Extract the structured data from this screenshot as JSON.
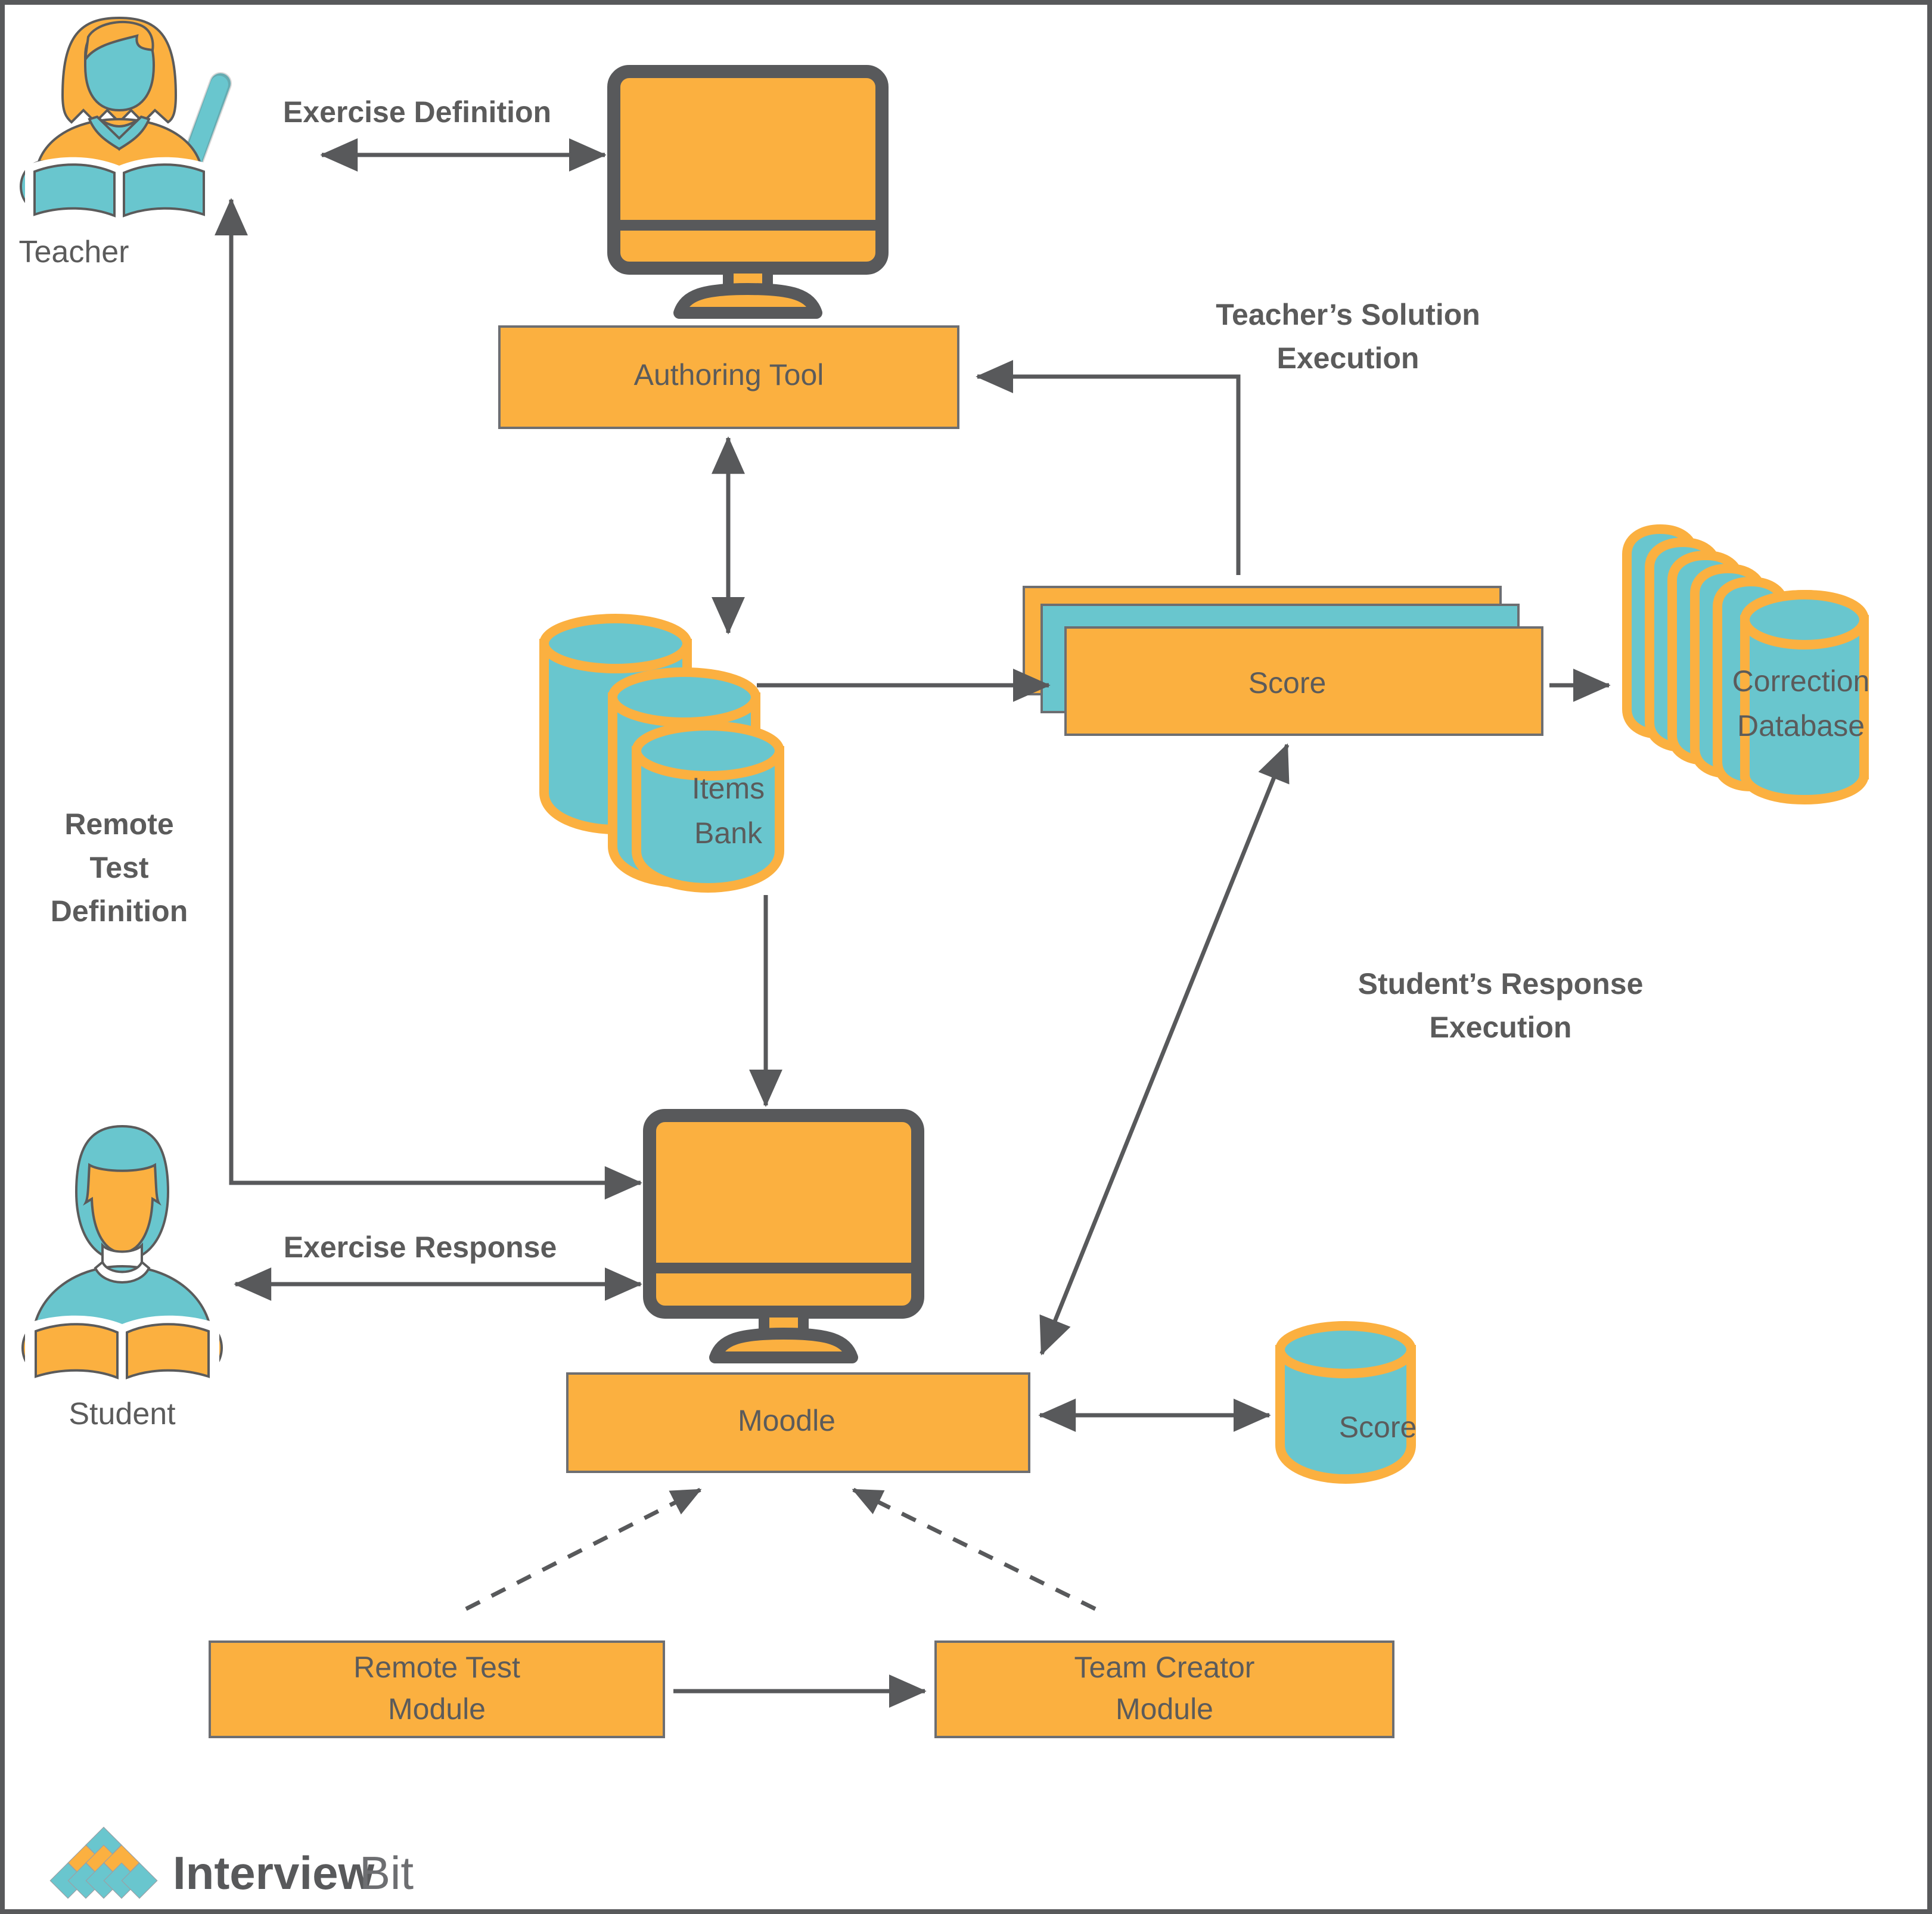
{
  "diagram": {
    "title": "Remote testing / assessment system architecture",
    "colors": {
      "orange": "#fbb040",
      "teal": "#69c6ce",
      "gray": "#58595b",
      "text": "#5b5b5b",
      "background": "#ffffff"
    },
    "actors": [
      {
        "id": "teacher",
        "label": "Teacher",
        "icon": "teacher-reading-icon"
      },
      {
        "id": "student",
        "label": "Student",
        "icon": "student-reading-icon"
      }
    ],
    "devices": [
      {
        "id": "teacher-monitor",
        "icon": "desktop-monitor-icon"
      },
      {
        "id": "student-monitor",
        "icon": "desktop-monitor-icon"
      }
    ],
    "nodes": [
      {
        "id": "authoring-tool",
        "label": "Authoring Tool",
        "shape": "rect",
        "fill": "#fbb040"
      },
      {
        "id": "items-bank",
        "label_line1": "Items",
        "label_line2": "Bank",
        "shape": "cylinder-stack-3",
        "fill": "#69c6ce"
      },
      {
        "id": "score-stack",
        "label": "Score",
        "shape": "layered-rect-3",
        "fill": "#fbb040"
      },
      {
        "id": "correction-database",
        "label_line1": "Correction",
        "label_line2": "Database",
        "shape": "cylinder-stack-horizontal",
        "fill": "#69c6ce"
      },
      {
        "id": "moodle",
        "label": "Moodle",
        "shape": "rect",
        "fill": "#fbb040"
      },
      {
        "id": "score-db",
        "label": "Score",
        "shape": "cylinder",
        "fill": "#69c6ce"
      },
      {
        "id": "remote-test-module",
        "label_line1": "Remote Test",
        "label_line2": "Module",
        "shape": "rect",
        "fill": "#fbb040"
      },
      {
        "id": "team-creator-module",
        "label_line1": "Team Creator",
        "label_line2": "Module",
        "shape": "rect",
        "fill": "#fbb040"
      }
    ],
    "edge_labels": {
      "exercise_definition": "Exercise Definition",
      "teachers_solution_execution_line1": "Teacher’s Solution",
      "teachers_solution_execution_line2": "Execution",
      "remote_test_definition_line1": "Remote",
      "remote_test_definition_line2": "Test",
      "remote_test_definition_line3": "Definition",
      "students_response_execution_line1": "Student’s Response",
      "students_response_execution_line2": "Execution",
      "exercise_response": "Exercise Response"
    },
    "edges": [
      {
        "from": "teacher",
        "to": "teacher-monitor",
        "label": "Exercise Definition",
        "arrow": "both",
        "style": "solid"
      },
      {
        "from": "teacher-monitor",
        "to": "authoring-tool",
        "arrow": "none",
        "style": "attached"
      },
      {
        "from": "authoring-tool",
        "to": "items-bank",
        "arrow": "both",
        "style": "solid"
      },
      {
        "from": "score-stack",
        "to": "authoring-tool",
        "label": "Teacher’s Solution Execution",
        "arrow": "to",
        "style": "solid"
      },
      {
        "from": "items-bank",
        "to": "score-stack",
        "arrow": "to",
        "style": "solid"
      },
      {
        "from": "score-stack",
        "to": "correction-database",
        "arrow": "to",
        "style": "solid"
      },
      {
        "from": "items-bank",
        "to": "student-monitor",
        "arrow": "to",
        "style": "solid"
      },
      {
        "from": "student",
        "to": "student-monitor",
        "label": "Exercise Response",
        "arrow": "both",
        "style": "solid"
      },
      {
        "from": "student-monitor",
        "to": "teacher",
        "label": "Remote Test Definition",
        "arrow": "to",
        "style": "solid"
      },
      {
        "from": "moodle",
        "to": "score-stack",
        "label": "Student’s Response Execution",
        "arrow": "both",
        "style": "solid"
      },
      {
        "from": "moodle",
        "to": "score-db",
        "arrow": "both",
        "style": "solid"
      },
      {
        "from": "remote-test-module",
        "to": "moodle",
        "arrow": "to",
        "style": "dashed"
      },
      {
        "from": "team-creator-module",
        "to": "moodle",
        "arrow": "to",
        "style": "dashed"
      },
      {
        "from": "remote-test-module",
        "to": "team-creator-module",
        "arrow": "to",
        "style": "solid"
      }
    ]
  },
  "branding": {
    "name_part1": "Interview",
    "name_part2": "Bit",
    "logo_icon": "interviewbit-diamond-logo"
  }
}
